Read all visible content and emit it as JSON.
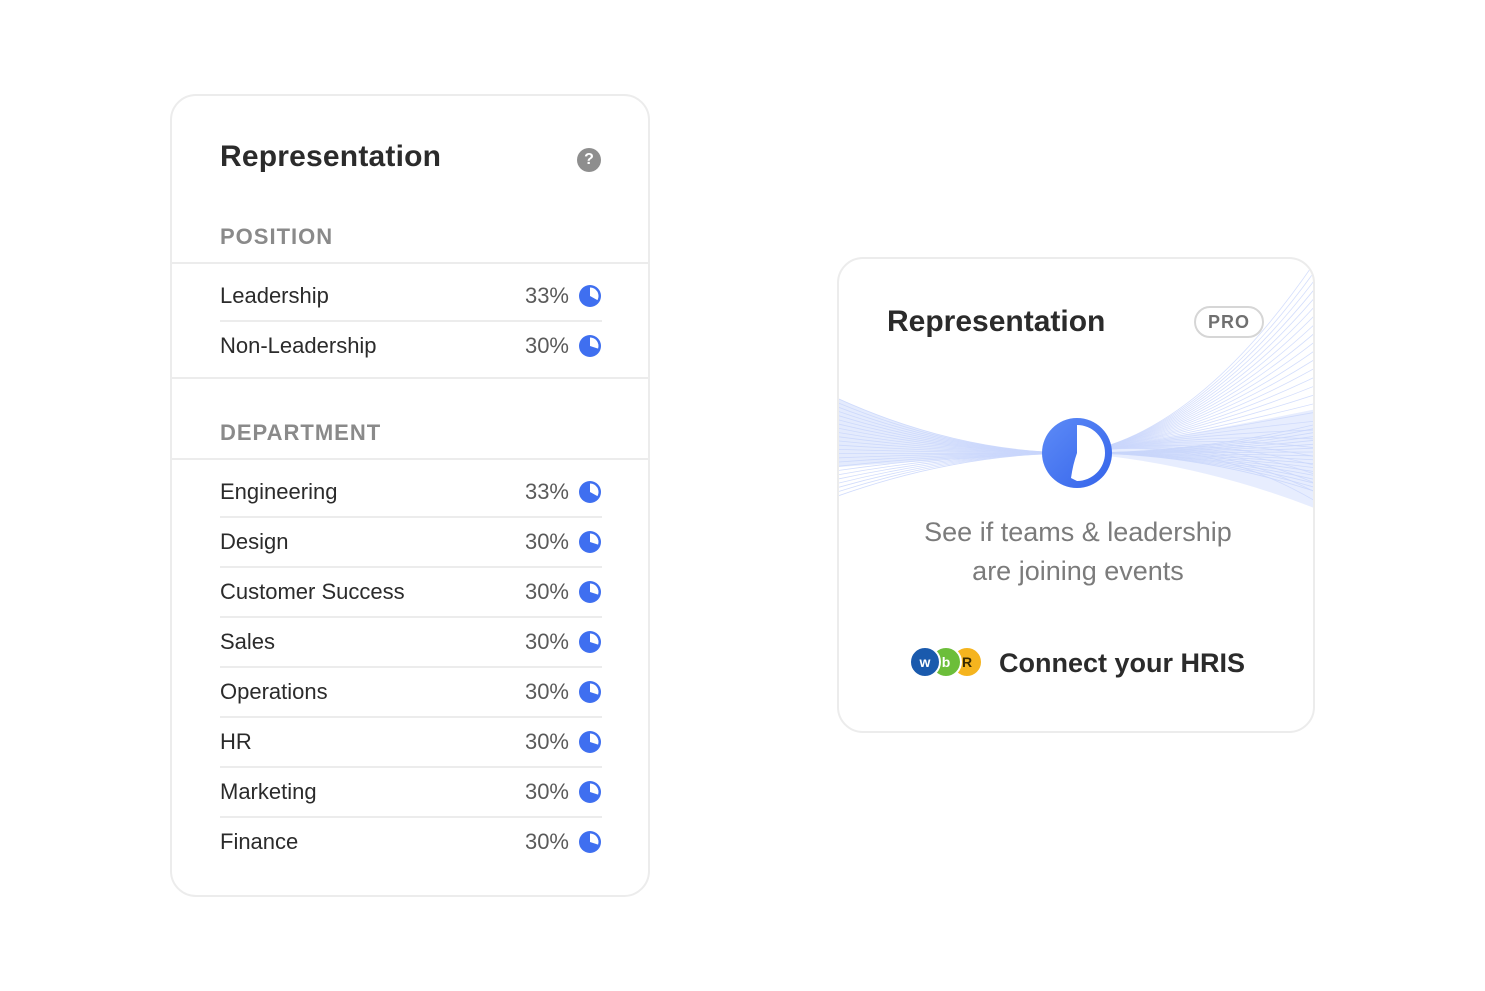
{
  "left_card": {
    "title": "Representation",
    "help_icon": "question-icon",
    "position": {
      "heading": "POSITION",
      "rows": [
        {
          "label": "Leadership",
          "value": "33%",
          "fraction": 0.33
        },
        {
          "label": "Non-Leadership",
          "value": "30%",
          "fraction": 0.3
        }
      ]
    },
    "department": {
      "heading": "DEPARTMENT",
      "rows": [
        {
          "label": "Engineering",
          "value": "33%",
          "fraction": 0.33
        },
        {
          "label": "Design",
          "value": "30%",
          "fraction": 0.3
        },
        {
          "label": "Customer Success",
          "value": "30%",
          "fraction": 0.3
        },
        {
          "label": "Sales",
          "value": "30%",
          "fraction": 0.3
        },
        {
          "label": "Operations",
          "value": "30%",
          "fraction": 0.3
        },
        {
          "label": "HR",
          "value": "30%",
          "fraction": 0.3
        },
        {
          "label": "Marketing",
          "value": "30%",
          "fraction": 0.3
        },
        {
          "label": "Finance",
          "value": "30%",
          "fraction": 0.3
        }
      ]
    }
  },
  "right_card": {
    "title": "Representation",
    "badge": "PRO",
    "description_line1": "See if teams & leadership",
    "description_line2": "are joining events",
    "connect_label": "Connect your HRIS",
    "logos": [
      {
        "icon": "workday-logo-icon",
        "letter": "w",
        "color": "#1a5aad"
      },
      {
        "icon": "bamboohr-logo-icon",
        "letter": "b",
        "color": "#6cbe3a"
      },
      {
        "icon": "rippling-logo-icon",
        "letter": "R",
        "color": "#f5b41e"
      }
    ]
  },
  "colors": {
    "accent": "#3f6ff0",
    "accent_light": "#dde6fd",
    "divider": "#ececec",
    "muted_text": "#8a8a8a"
  }
}
